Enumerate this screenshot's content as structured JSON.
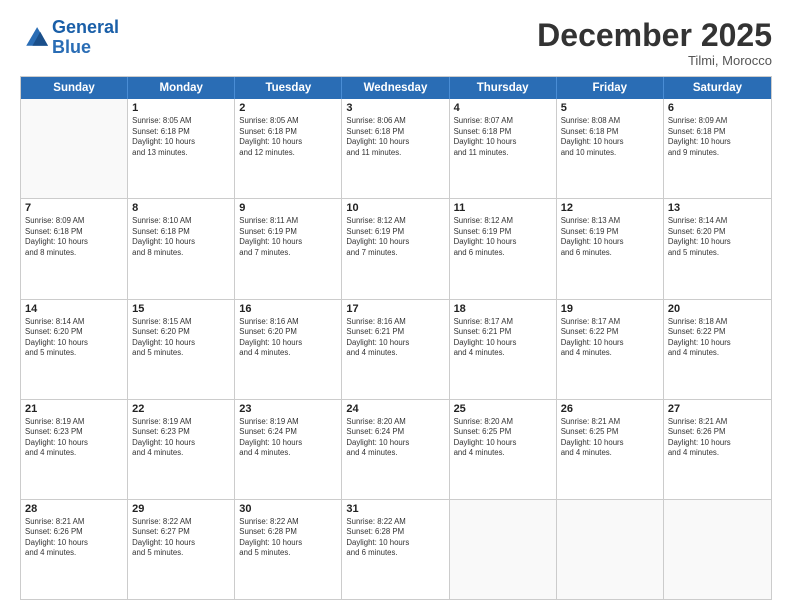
{
  "logo": {
    "line1": "General",
    "line2": "Blue"
  },
  "title": "December 2025",
  "subtitle": "Tilmi, Morocco",
  "header_days": [
    "Sunday",
    "Monday",
    "Tuesday",
    "Wednesday",
    "Thursday",
    "Friday",
    "Saturday"
  ],
  "rows": [
    [
      {
        "day": "",
        "info": ""
      },
      {
        "day": "1",
        "info": "Sunrise: 8:05 AM\nSunset: 6:18 PM\nDaylight: 10 hours\nand 13 minutes."
      },
      {
        "day": "2",
        "info": "Sunrise: 8:05 AM\nSunset: 6:18 PM\nDaylight: 10 hours\nand 12 minutes."
      },
      {
        "day": "3",
        "info": "Sunrise: 8:06 AM\nSunset: 6:18 PM\nDaylight: 10 hours\nand 11 minutes."
      },
      {
        "day": "4",
        "info": "Sunrise: 8:07 AM\nSunset: 6:18 PM\nDaylight: 10 hours\nand 11 minutes."
      },
      {
        "day": "5",
        "info": "Sunrise: 8:08 AM\nSunset: 6:18 PM\nDaylight: 10 hours\nand 10 minutes."
      },
      {
        "day": "6",
        "info": "Sunrise: 8:09 AM\nSunset: 6:18 PM\nDaylight: 10 hours\nand 9 minutes."
      }
    ],
    [
      {
        "day": "7",
        "info": "Sunrise: 8:09 AM\nSunset: 6:18 PM\nDaylight: 10 hours\nand 8 minutes."
      },
      {
        "day": "8",
        "info": "Sunrise: 8:10 AM\nSunset: 6:18 PM\nDaylight: 10 hours\nand 8 minutes."
      },
      {
        "day": "9",
        "info": "Sunrise: 8:11 AM\nSunset: 6:19 PM\nDaylight: 10 hours\nand 7 minutes."
      },
      {
        "day": "10",
        "info": "Sunrise: 8:12 AM\nSunset: 6:19 PM\nDaylight: 10 hours\nand 7 minutes."
      },
      {
        "day": "11",
        "info": "Sunrise: 8:12 AM\nSunset: 6:19 PM\nDaylight: 10 hours\nand 6 minutes."
      },
      {
        "day": "12",
        "info": "Sunrise: 8:13 AM\nSunset: 6:19 PM\nDaylight: 10 hours\nand 6 minutes."
      },
      {
        "day": "13",
        "info": "Sunrise: 8:14 AM\nSunset: 6:20 PM\nDaylight: 10 hours\nand 5 minutes."
      }
    ],
    [
      {
        "day": "14",
        "info": "Sunrise: 8:14 AM\nSunset: 6:20 PM\nDaylight: 10 hours\nand 5 minutes."
      },
      {
        "day": "15",
        "info": "Sunrise: 8:15 AM\nSunset: 6:20 PM\nDaylight: 10 hours\nand 5 minutes."
      },
      {
        "day": "16",
        "info": "Sunrise: 8:16 AM\nSunset: 6:20 PM\nDaylight: 10 hours\nand 4 minutes."
      },
      {
        "day": "17",
        "info": "Sunrise: 8:16 AM\nSunset: 6:21 PM\nDaylight: 10 hours\nand 4 minutes."
      },
      {
        "day": "18",
        "info": "Sunrise: 8:17 AM\nSunset: 6:21 PM\nDaylight: 10 hours\nand 4 minutes."
      },
      {
        "day": "19",
        "info": "Sunrise: 8:17 AM\nSunset: 6:22 PM\nDaylight: 10 hours\nand 4 minutes."
      },
      {
        "day": "20",
        "info": "Sunrise: 8:18 AM\nSunset: 6:22 PM\nDaylight: 10 hours\nand 4 minutes."
      }
    ],
    [
      {
        "day": "21",
        "info": "Sunrise: 8:19 AM\nSunset: 6:23 PM\nDaylight: 10 hours\nand 4 minutes."
      },
      {
        "day": "22",
        "info": "Sunrise: 8:19 AM\nSunset: 6:23 PM\nDaylight: 10 hours\nand 4 minutes."
      },
      {
        "day": "23",
        "info": "Sunrise: 8:19 AM\nSunset: 6:24 PM\nDaylight: 10 hours\nand 4 minutes."
      },
      {
        "day": "24",
        "info": "Sunrise: 8:20 AM\nSunset: 6:24 PM\nDaylight: 10 hours\nand 4 minutes."
      },
      {
        "day": "25",
        "info": "Sunrise: 8:20 AM\nSunset: 6:25 PM\nDaylight: 10 hours\nand 4 minutes."
      },
      {
        "day": "26",
        "info": "Sunrise: 8:21 AM\nSunset: 6:25 PM\nDaylight: 10 hours\nand 4 minutes."
      },
      {
        "day": "27",
        "info": "Sunrise: 8:21 AM\nSunset: 6:26 PM\nDaylight: 10 hours\nand 4 minutes."
      }
    ],
    [
      {
        "day": "28",
        "info": "Sunrise: 8:21 AM\nSunset: 6:26 PM\nDaylight: 10 hours\nand 4 minutes."
      },
      {
        "day": "29",
        "info": "Sunrise: 8:22 AM\nSunset: 6:27 PM\nDaylight: 10 hours\nand 5 minutes."
      },
      {
        "day": "30",
        "info": "Sunrise: 8:22 AM\nSunset: 6:28 PM\nDaylight: 10 hours\nand 5 minutes."
      },
      {
        "day": "31",
        "info": "Sunrise: 8:22 AM\nSunset: 6:28 PM\nDaylight: 10 hours\nand 6 minutes."
      },
      {
        "day": "",
        "info": ""
      },
      {
        "day": "",
        "info": ""
      },
      {
        "day": "",
        "info": ""
      }
    ]
  ]
}
